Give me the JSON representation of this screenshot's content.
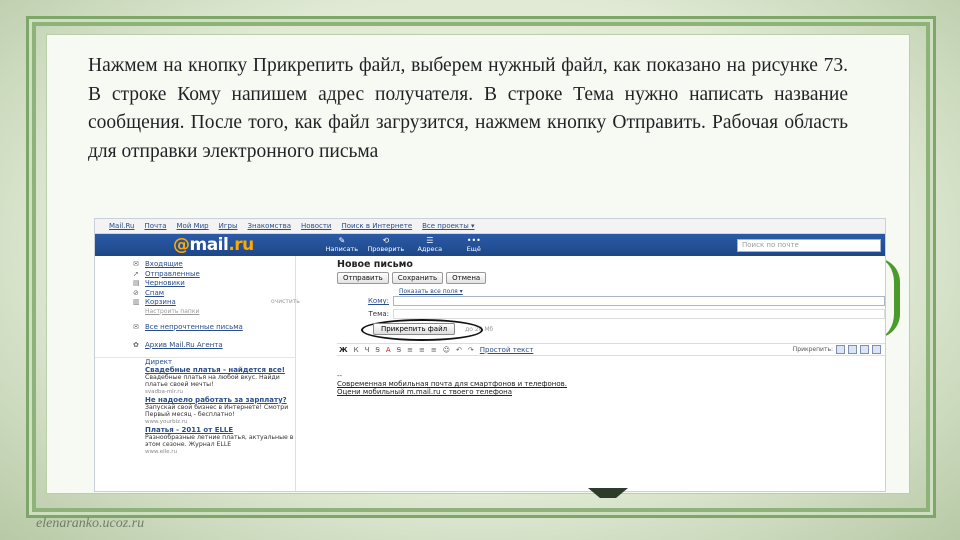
{
  "slide": {
    "paragraph": "Нажмем на кнопку Прикрепить файл, выберем нужный файл, как показано на рисунке 73. В строке Кому  напишем адрес получателя. В строке Тема нужно написать название сообщения. После того, как файл загрузится,  нажмем  кнопку Отправить. Рабочая область для отправки электронного письма",
    "footer_url": "elenaranko.ucoz.ru"
  },
  "screenshot": {
    "topbar_links": [
      "Mail.Ru",
      "Почта",
      "Мой Мир",
      "Игры",
      "Знакомства",
      "Новости",
      "Поиск в Интернете",
      "Все проекты ▾"
    ],
    "logo": {
      "at": "@",
      "name": "mail",
      "tld": ".ru"
    },
    "header_buttons": [
      {
        "icon": "✎",
        "label": "Написать"
      },
      {
        "icon": "⟲",
        "label": "Проверить"
      },
      {
        "icon": "☰",
        "label": "Адреса"
      },
      {
        "icon": "•••",
        "label": "Ещё"
      }
    ],
    "search_placeholder": "Поиск по почте",
    "folders": [
      {
        "icon": "✉",
        "label": "Входящие",
        "count": ""
      },
      {
        "icon": "➚",
        "label": "Отправленные",
        "count": ""
      },
      {
        "icon": "▤",
        "label": "Черновики",
        "count": ""
      },
      {
        "icon": "⊘",
        "label": "Спам",
        "count": ""
      },
      {
        "icon": "▥",
        "label": "Корзина",
        "count": "очистить"
      }
    ],
    "setup_folders": "Настроить папки",
    "unread_link": "Все непрочтенные письма",
    "agent_link": "Архив Mail.Ru Агента",
    "direct_label": "Директ",
    "ads": [
      {
        "title": "Свадебные платья - найдется все!",
        "text": "Свадебные платья на любой вкус. Найди платье своей мечты!",
        "url": "svadba-mir.ru"
      },
      {
        "title": "Не надоело работать за зарплату?",
        "text": "Запускай свой бизнес в Интернете! Смотри Первый месяц - бесплатно!",
        "url": "www.yourbiz.ru"
      },
      {
        "title": "Платья - 2011 от ELLE",
        "text": "Разнообразные летние платья, актуальные в этом сезоне. Журнал ELLE",
        "url": "www.elle.ru"
      }
    ],
    "compose": {
      "title": "Новое письмо",
      "toolbar": [
        "Отправить",
        "Сохранить",
        "Отмена"
      ],
      "show_all_fields": "Показать все поля ▾",
      "to_label": "Кому:",
      "to_value": "",
      "subject_label": "Тема:",
      "subject_value": "",
      "attach_button": "Прикрепить файл",
      "attach_hint": "до 20 Мб",
      "format_items": [
        "Ж",
        "К",
        "Ч",
        "Ꞩ",
        "A",
        "Ꞩ",
        "≡",
        "≡",
        "≡",
        "☺",
        "↶",
        "↷"
      ],
      "plain_text": "Простой текст",
      "attach_more_label": "Прикрепить:",
      "signature_line1": "Современная мобильная почта  для смартфонов и телефонов.",
      "signature_line2": "Оцени мобильный m.mail.ru с твоего телефона"
    }
  }
}
